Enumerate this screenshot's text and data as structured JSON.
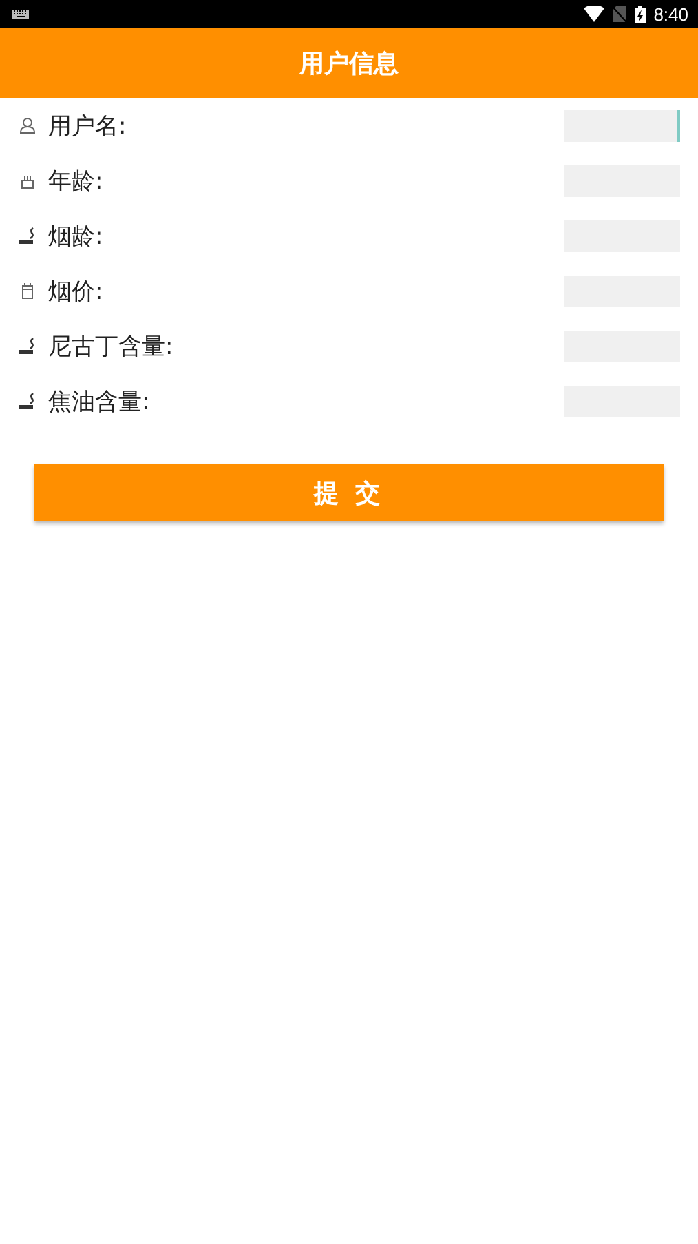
{
  "status_bar": {
    "time": "8:40"
  },
  "header": {
    "title": "用户信息"
  },
  "fields": [
    {
      "kind": "person",
      "label": "用户名:",
      "focused": true
    },
    {
      "kind": "cake",
      "label": "年龄:",
      "focused": false
    },
    {
      "kind": "cigarette",
      "label": "烟龄:",
      "focused": false
    },
    {
      "kind": "pack",
      "label": "烟价:",
      "focused": false
    },
    {
      "kind": "cigarette",
      "label": "尼古丁含量:",
      "focused": false
    },
    {
      "kind": "cigarette",
      "label": "焦油含量:",
      "focused": false
    }
  ],
  "submit_button": {
    "label": "提 交"
  }
}
